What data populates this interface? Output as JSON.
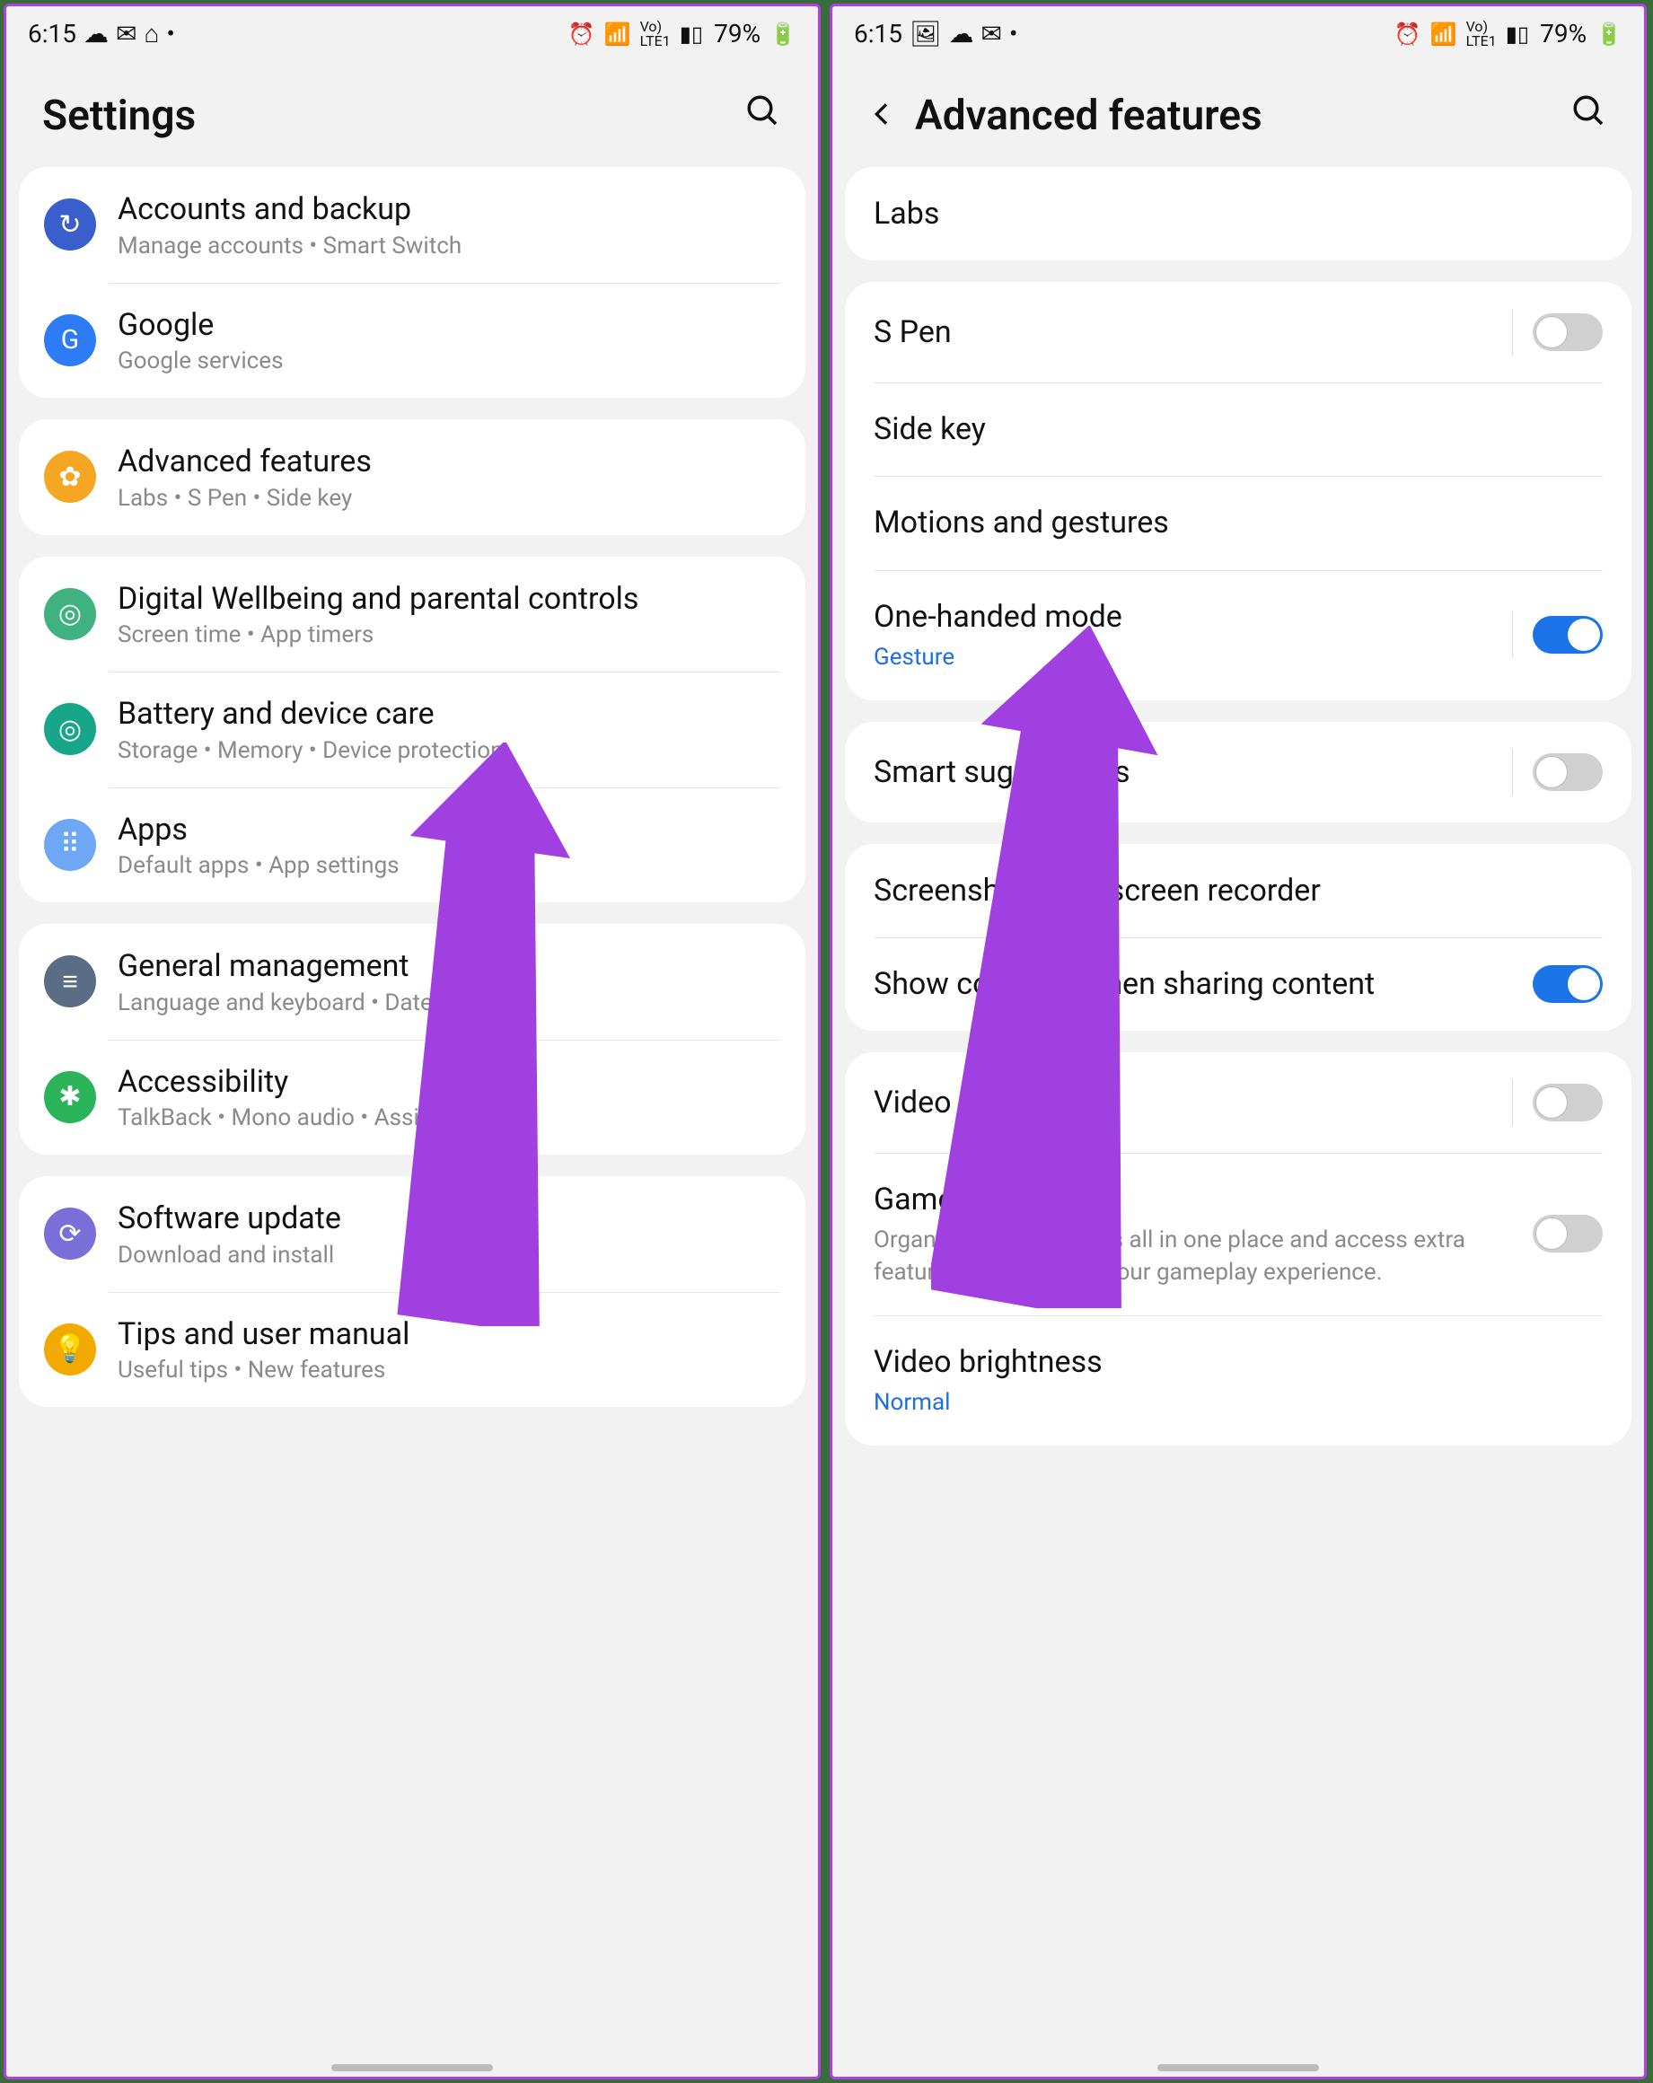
{
  "statusbar": {
    "time": "6:15",
    "battery": "79%",
    "lte": "LTE1",
    "vo": "Vo)"
  },
  "left": {
    "title": "Settings",
    "groups": [
      [
        {
          "iconBg": "#3a5fcd",
          "glyph": "↻",
          "title": "Accounts and backup",
          "sub": "Manage accounts  •  Smart Switch"
        },
        {
          "iconBg": "#2e7bf6",
          "glyph": "G",
          "title": "Google",
          "sub": "Google services"
        }
      ],
      [
        {
          "iconBg": "#f5a623",
          "glyph": "✿",
          "title": "Advanced features",
          "sub": "Labs  •  S Pen  •  Side key"
        }
      ],
      [
        {
          "iconBg": "#3fb27f",
          "glyph": "◎",
          "title": "Digital Wellbeing and parental controls",
          "sub": "Screen time  •  App timers"
        },
        {
          "iconBg": "#17a68a",
          "glyph": "◎",
          "title": "Battery and device care",
          "sub": "Storage  •  Memory  •  Device protection"
        },
        {
          "iconBg": "#6ea8f5",
          "glyph": "⠿",
          "title": "Apps",
          "sub": "Default apps  •  App settings"
        }
      ],
      [
        {
          "iconBg": "#5a6d84",
          "glyph": "≡",
          "title": "General management",
          "sub": "Language and keyboard  •  Date and time"
        },
        {
          "iconBg": "#2bb35a",
          "glyph": "✱",
          "title": "Accessibility",
          "sub": "TalkBack  •  Mono audio  •  Assistant menu"
        }
      ],
      [
        {
          "iconBg": "#7a6fd8",
          "glyph": "⟳",
          "title": "Software update",
          "sub": "Download and install"
        },
        {
          "iconBg": "#f2a900",
          "glyph": "💡",
          "title": "Tips and user manual",
          "sub": "Useful tips  •  New features"
        }
      ]
    ]
  },
  "right": {
    "title": "Advanced features",
    "groups": [
      [
        {
          "title": "Labs"
        }
      ],
      [
        {
          "title": "S Pen",
          "toggle": "off",
          "div": true
        },
        {
          "title": "Side key"
        },
        {
          "title": "Motions and gestures"
        },
        {
          "title": "One-handed mode",
          "sub": "Gesture",
          "subLink": true,
          "toggle": "on",
          "div": true
        }
      ],
      [
        {
          "title": "Smart suggestions",
          "toggle": "off",
          "div": true
        }
      ],
      [
        {
          "title": "Screenshots and screen recorder"
        },
        {
          "title": "Show contacts when sharing content",
          "toggle": "on"
        }
      ],
      [
        {
          "title": "Video call effects",
          "toggle": "off",
          "div": true
        },
        {
          "title": "Game Launcher",
          "sub": "Organise all your games all in one place and access extra features that enhance your gameplay experience.",
          "toggle": "off"
        },
        {
          "title": "Video brightness",
          "sub": "Normal",
          "subLink": true
        }
      ]
    ]
  }
}
